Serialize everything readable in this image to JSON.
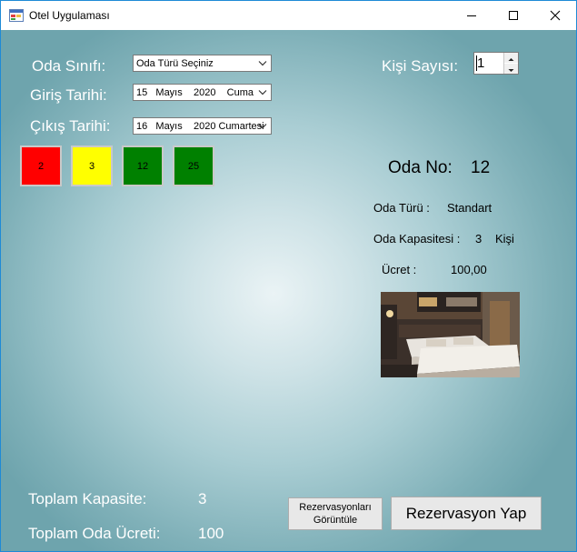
{
  "window": {
    "title": "Otel Uygulaması"
  },
  "form": {
    "room_class_label": "Oda Sınıfı:",
    "room_class_value": "Oda Türü Seçiniz",
    "checkin_label": "Giriş Tarihi:",
    "checkin_value": "15   Mayıs    2020    Cuma",
    "checkout_label": "Çıkış Tarihi:",
    "checkout_value": "16   Mayıs    2020 Cumartesi",
    "person_count_label": "Kişi Sayısı:",
    "person_count_value": "1"
  },
  "rooms": [
    {
      "number": "2",
      "color": "#ff0000"
    },
    {
      "number": "3",
      "color": "#ffff00"
    },
    {
      "number": "12",
      "color": "#008000"
    },
    {
      "number": "25",
      "color": "#008000"
    }
  ],
  "details": {
    "room_no_label": "Oda No:",
    "room_no_value": "12",
    "room_type_label": "Oda Türü :",
    "room_type_value": "Standart",
    "capacity_label": "Oda Kapasitesi :",
    "capacity_value": "3",
    "capacity_unit": "Kişi",
    "price_label": "Ücret :",
    "price_value": "100,00"
  },
  "totals": {
    "capacity_label": "Toplam Kapasite:",
    "capacity_value": "3",
    "price_label": "Toplam Oda Ücreti:",
    "price_value": "100"
  },
  "buttons": {
    "view_reservations_line1": "Rezervasyonları",
    "view_reservations_line2": "Görüntüle",
    "make_reservation": "Rezervasyon Yap"
  },
  "icons": {
    "app": "app-window-icon",
    "minimize": "minimize-icon",
    "maximize": "maximize-icon",
    "close": "close-icon",
    "dropdown": "chevron-down-icon",
    "spin_up": "spin-up-icon",
    "spin_down": "spin-down-icon"
  }
}
